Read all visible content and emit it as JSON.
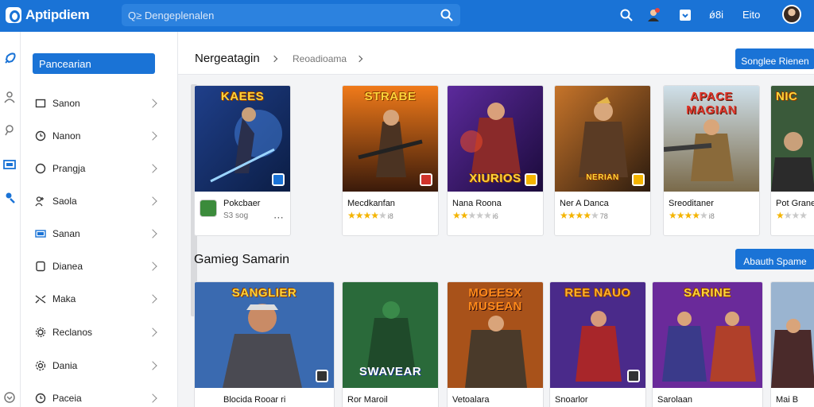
{
  "app": {
    "name": "Aptipdiem",
    "search_placeholder": "Q≥ Dengeplenalen",
    "top_text_1": "ǿ8i",
    "top_text_2": "Eito",
    "colors": {
      "brand": "#1a73d6",
      "star": "#f4b400"
    }
  },
  "sidebar": {
    "active": "Pancearian",
    "items": [
      {
        "label": "Sanon",
        "icon": "square-icon"
      },
      {
        "label": "Nanon",
        "icon": "clock-icon"
      },
      {
        "label": "Prangja",
        "icon": "circle-icon"
      },
      {
        "label": "Saola",
        "icon": "users-icon"
      },
      {
        "label": "Sanan",
        "icon": "screen-icon"
      },
      {
        "label": "Dianea",
        "icon": "tag-icon"
      },
      {
        "label": "Maka",
        "icon": "shuffle-icon"
      },
      {
        "label": "Reclanos",
        "icon": "gear-icon"
      },
      {
        "label": "Dania",
        "icon": "settings-icon"
      },
      {
        "label": "Paceia",
        "icon": "clock-icon"
      }
    ]
  },
  "header": {
    "breadcrumb": "Nergeatagin",
    "sub": "Reoadioama",
    "button": "Songlee Rienen"
  },
  "section1": {
    "cards": [
      {
        "logo": "KAEES",
        "title": "Pokcbaer",
        "sub": "S3 sog",
        "rating": 0,
        "rating_text": ""
      },
      {
        "logo": "STRABE",
        "title": "Mecdkanfan",
        "sub": "",
        "rating": 4,
        "rating_text": "i8"
      },
      {
        "logo": "XIURIOS",
        "title": "Nana Roona",
        "sub": "",
        "rating": 2,
        "rating_text": "i6"
      },
      {
        "logo": "NERIAN",
        "title": "Ner A Danca",
        "sub": "",
        "rating": 4,
        "rating_text": "78"
      },
      {
        "logo": "APACE MAGIAN",
        "title": "Sreoditaner",
        "sub": "",
        "rating": 4,
        "rating_text": "i8"
      },
      {
        "logo": "NIC",
        "title": "Pot Grane",
        "sub": "",
        "rating": 1,
        "rating_text": ""
      }
    ]
  },
  "section2": {
    "title": "Gamieg Samarin",
    "button": "Abauth Spame",
    "cards": [
      {
        "logo": "SANGLIER",
        "title": "Blocida Rooar ri",
        "sub": ""
      },
      {
        "logo": "SWAVEAR",
        "title": "Ror Maroil",
        "sub": ""
      },
      {
        "logo": "MOEESX MUSEAN",
        "title": "Vetoalara",
        "sub": ""
      },
      {
        "logo": "REE NAUO",
        "title": "Snoarlor",
        "sub": ""
      },
      {
        "logo": "SARINE",
        "title": "Sarolaan",
        "sub": ""
      },
      {
        "logo": "",
        "title": "Mai B",
        "sub": ""
      }
    ]
  }
}
